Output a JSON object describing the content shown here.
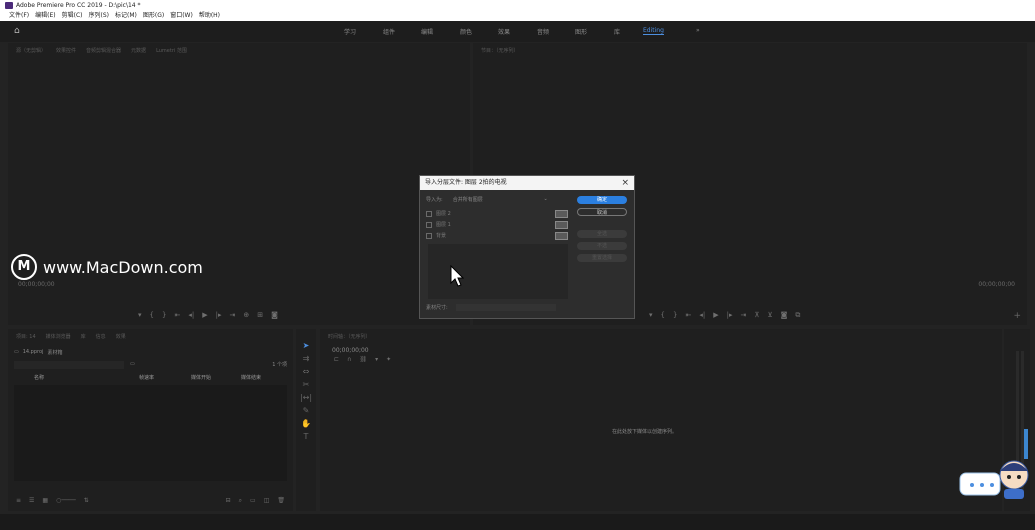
{
  "window": {
    "title": "Adobe Premiere Pro CC 2019 - D:\\pic\\14 *"
  },
  "menubar": [
    "文件(F)",
    "编辑(E)",
    "剪辑(C)",
    "序列(S)",
    "标记(M)",
    "图形(G)",
    "窗口(W)",
    "帮助(H)"
  ],
  "workspace_tabs": [
    "学习",
    "组件",
    "编辑",
    "颜色",
    "效果",
    "音频",
    "图形",
    "库",
    "Editing",
    "»"
  ],
  "source_monitor": {
    "tabs": [
      "源（无剪辑）",
      "效果控件",
      "音频剪辑混合器",
      "元数据",
      "Lumetri 范围"
    ],
    "timecode_left": "00;00;00;00"
  },
  "program_monitor": {
    "tab": "节目：（无序列）",
    "timecode_right": "00;00;00;00"
  },
  "project_panel": {
    "tabs": [
      "项目: 14",
      "媒体浏览器",
      "库",
      "信息",
      "效果"
    ],
    "project_name": "14.pproj",
    "bin_label": "素材箱",
    "item_count": "1 个项",
    "columns": [
      "名称",
      "帧速率",
      "媒体开始",
      "媒体结束"
    ]
  },
  "timeline": {
    "tab": "时间轴：（无序列）",
    "timecode": "00;00;00;00",
    "drop_hint": "在此处放下媒体以创建序列。"
  },
  "dialog": {
    "title": "导入分层文件: 图层 2拍的电视",
    "import_as_label": "导入为:",
    "import_as_value": "合并所有图层",
    "ok_label": "确定",
    "cancel_label": "取消",
    "layers": [
      "图层 2",
      "图层 1",
      "背景"
    ],
    "side_buttons": [
      "全选",
      "不选",
      "重置选择"
    ],
    "footage_size_label": "素材尺寸:"
  },
  "watermark": {
    "text": "www.MacDown.com",
    "logo_letter": "M"
  }
}
